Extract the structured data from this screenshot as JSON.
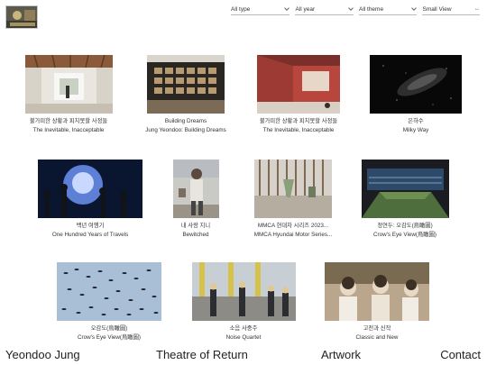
{
  "filters": [
    {
      "label": "All type"
    },
    {
      "label": "All year"
    },
    {
      "label": "All theme"
    },
    {
      "label": "Small View",
      "arrows": "↔"
    }
  ],
  "works": [
    {
      "title_ko": "불가피한 상황과 피치못할 사정들",
      "title_en": "The Inevitable, Inacceptable"
    },
    {
      "title_ko": "Building Dreams",
      "title_en": "Jung Yeondoo: Building Dreams"
    },
    {
      "title_ko": "불가피한 상황과 피치못할 사정들",
      "title_en": "The Inevitable, Inacceptable"
    },
    {
      "title_ko": "은하수",
      "title_en": "Milky Way"
    },
    {
      "title_ko": "백년 여행기",
      "title_en": "One Hundred Years of Travels"
    },
    {
      "title_ko": "내 사랑 지니",
      "title_en": "Bewitched"
    },
    {
      "title_ko": "MMCA 현대차 시리즈 2023...",
      "title_en": "MMCA Hyundai Motor Series..."
    },
    {
      "title_ko": "정연두: 오감도(烏瞰圖)",
      "title_en": "Crow's Eye View(烏瞰圖)"
    },
    {
      "title_ko": "오감도(烏瞰圖)",
      "title_en": "Crow's Eye View(烏瞰圖)"
    },
    {
      "title_ko": "소음 사중주",
      "title_en": "Noise Quartet"
    },
    {
      "title_ko": "고전과 신작",
      "title_en": "Classic and New"
    }
  ],
  "nav": {
    "name": "Yeondoo Jung",
    "theatre": "Theatre of Return",
    "artwork": "Artwork",
    "contact": "Contact"
  }
}
